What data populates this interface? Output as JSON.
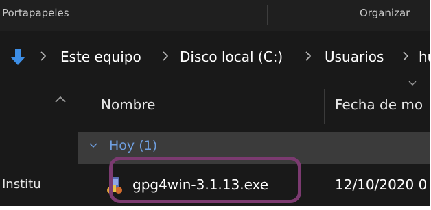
{
  "ribbon": {
    "groups": [
      "Portapapeles",
      "Organizar"
    ]
  },
  "address_bar": {
    "icon": "download-arrow-icon",
    "crumbs": [
      "Este equipo",
      "Disco local (C:)",
      "Usuarios",
      "hu"
    ]
  },
  "columns": {
    "name": "Nombre",
    "date": "Fecha de mo"
  },
  "navigation_pane": {
    "item_label": "Institu"
  },
  "file_list": {
    "group_label": "Hoy (1)",
    "files": [
      {
        "name": "gpg4win-3.1.13.exe",
        "date": "12/10/2020 0",
        "icon": "installer-icon"
      }
    ]
  },
  "colors": {
    "background": "#191919",
    "group_row": "#3b3b3b",
    "group_label": "#6f9fe0",
    "accent_arrow": "#3d8ee6",
    "highlight_border": "#7b3a70"
  }
}
